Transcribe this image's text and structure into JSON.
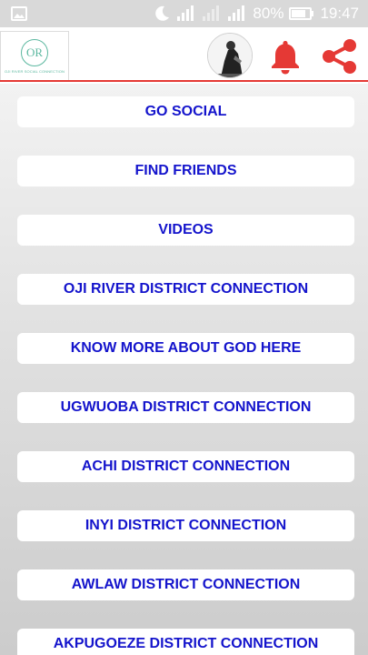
{
  "status_bar": {
    "battery": "80%",
    "time": "19:47",
    "icons": [
      "gallery-icon",
      "moon-icon",
      "signal-icon",
      "signal-icon",
      "battery-icon"
    ]
  },
  "app_bar": {
    "logo": {
      "initials": "OR",
      "subtitle": "OJI RIVER SOCIAL CONNECTION"
    },
    "icons": [
      "avatar",
      "bell-icon",
      "share-icon"
    ],
    "colors": {
      "accent": "#e53935",
      "link_text": "#1414cc"
    }
  },
  "menu": [
    {
      "label": "GO SOCIAL"
    },
    {
      "label": "FIND FRIENDS"
    },
    {
      "label": "VIDEOS"
    },
    {
      "label": "OJI RIVER DISTRICT CONNECTION"
    },
    {
      "label": "KNOW MORE ABOUT GOD HERE"
    },
    {
      "label": "UGWUOBA DISTRICT CONNECTION"
    },
    {
      "label": "ACHI DISTRICT CONNECTION"
    },
    {
      "label": "INYI DISTRICT CONNECTION"
    },
    {
      "label": "AWLAW DISTRICT CONNECTION"
    },
    {
      "label": "AKPUGOEZE DISTRICT CONNECTION"
    }
  ]
}
